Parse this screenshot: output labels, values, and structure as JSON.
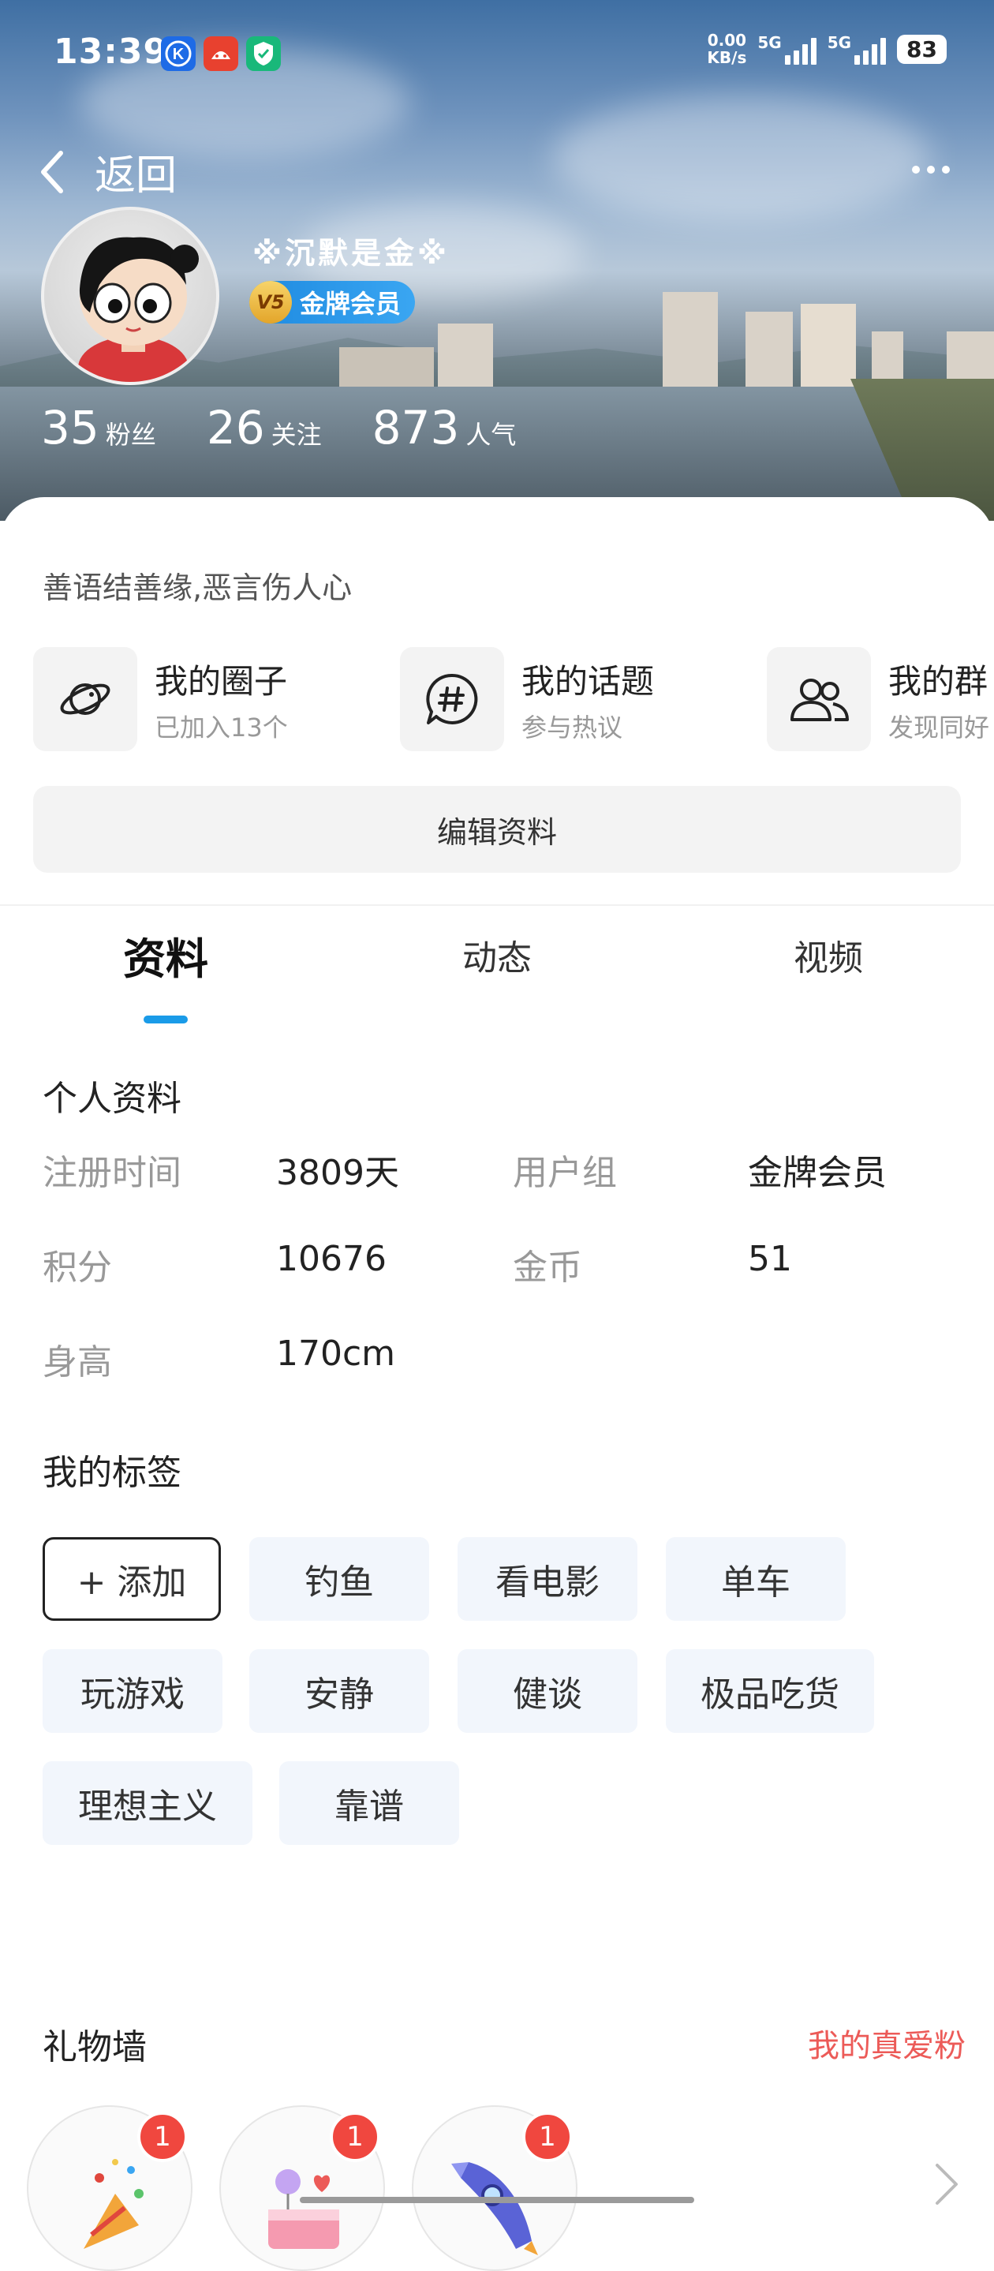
{
  "status_bar": {
    "time": "13:39",
    "net_speed_value": "0.00",
    "net_speed_unit": "KB/s",
    "signal1": "5G",
    "signal2": "5G",
    "battery": "83"
  },
  "nav": {
    "back_label": "返回"
  },
  "profile": {
    "username": "※沉默是金※",
    "vip_level": "V5",
    "vip_label": "金牌会员",
    "stats": [
      {
        "num": "35",
        "label": "粉丝"
      },
      {
        "num": "26",
        "label": "关注"
      },
      {
        "num": "873",
        "label": "人气"
      }
    ],
    "signature": "善语结善缘,恶言伤人心"
  },
  "quick_links": [
    {
      "title": "我的圈子",
      "subtitle": "已加入13个",
      "icon": "planet-icon"
    },
    {
      "title": "我的话题",
      "subtitle": "参与热议",
      "icon": "hashtag-chat-icon"
    },
    {
      "title": "我的群",
      "subtitle": "发现同好",
      "icon": "group-people-icon"
    }
  ],
  "edit_button": "编辑资料",
  "tabs": [
    "资料",
    "动态",
    "视频"
  ],
  "personal_info": {
    "title": "个人资料",
    "rows": [
      {
        "k1": "注册时间",
        "v1": "3809天",
        "k2": "用户组",
        "v2": "金牌会员"
      },
      {
        "k1": "积分",
        "v1": "10676",
        "k2": "金币",
        "v2": "51"
      },
      {
        "k1": "身高",
        "v1": "170cm",
        "k2": "",
        "v2": ""
      }
    ]
  },
  "tags": {
    "title": "我的标签",
    "add_label": "+ 添加",
    "items": [
      "钓鱼",
      "看电影",
      "单车",
      "玩游戏",
      "安静",
      "健谈",
      "极品吃货",
      "理想主义",
      "靠谱"
    ]
  },
  "gifts": {
    "title": "礼物墙",
    "link": "我的真爱粉",
    "items": [
      {
        "count": "1",
        "icon": "party-popper-icon"
      },
      {
        "count": "1",
        "icon": "cake-gift-icon"
      },
      {
        "count": "1",
        "icon": "rocket-gift-icon"
      }
    ]
  },
  "colors": {
    "accent": "#1a9be8",
    "vip_blue": "#2a97ea",
    "link_red": "#ec5b58",
    "badge_red": "#f0473f"
  }
}
